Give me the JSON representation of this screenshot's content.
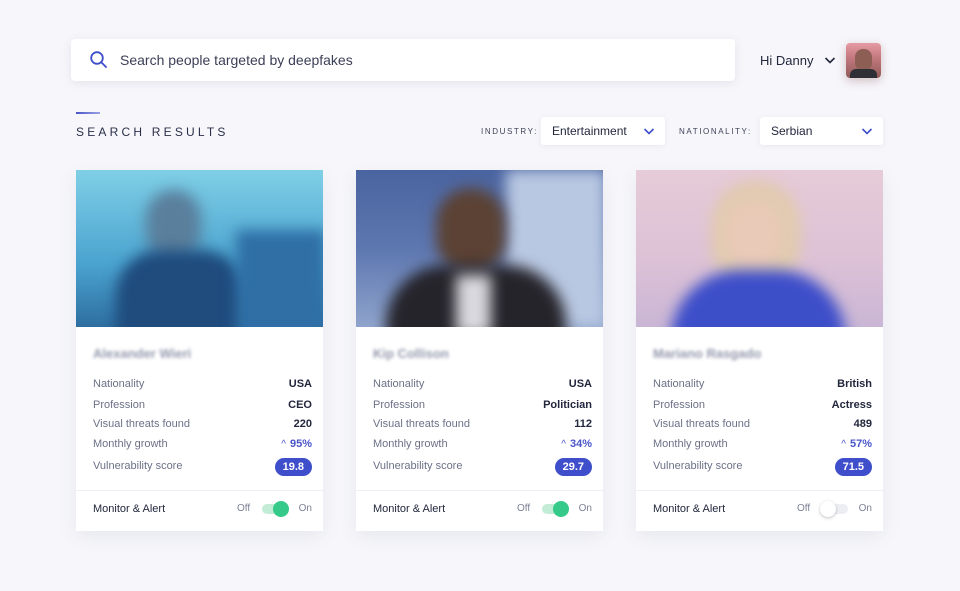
{
  "search": {
    "placeholder": "Search people targeted by deepfakes"
  },
  "user": {
    "greeting": "Hi Danny"
  },
  "results": {
    "title": "SEARCH RESULTS"
  },
  "filters": {
    "industry": {
      "label": "INDUSTRY:",
      "value": "Entertainment"
    },
    "nationality": {
      "label": "NATIONALITY:",
      "value": "Serbian"
    }
  },
  "labels": {
    "nationality": "Nationality",
    "profession": "Profession",
    "threats": "Visual threats found",
    "growth": "Monthly growth",
    "score": "Vulnerability score",
    "monitor": "Monitor & Alert",
    "off": "Off",
    "on": "On"
  },
  "people": [
    {
      "name": "Alexander Wieri",
      "nationality": "USA",
      "profession": "CEO",
      "threats": "220",
      "growth": "95%",
      "score": "19.8",
      "monitoring": true
    },
    {
      "name": "Kip Collison",
      "nationality": "USA",
      "profession": "Politician",
      "threats": "112",
      "growth": "34%",
      "score": "29.7",
      "monitoring": true
    },
    {
      "name": "Mariano Rasgado",
      "nationality": "British",
      "profession": "Actress",
      "threats": "489",
      "growth": "57%",
      "score": "71.5",
      "monitoring": false
    }
  ],
  "colors": {
    "accent": "#3f4ecb",
    "toggle_on": "#35c98a"
  },
  "icons": {
    "search": "search-icon",
    "dropdown": "chevron-down-icon"
  }
}
